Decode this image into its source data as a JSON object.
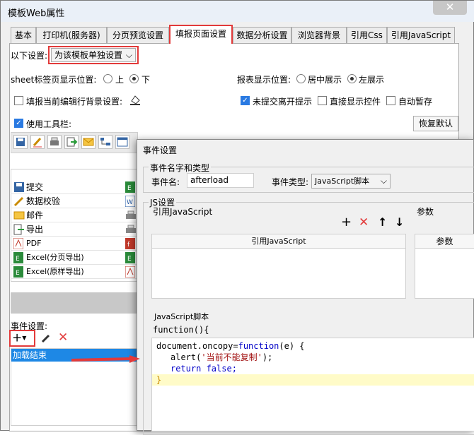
{
  "window": {
    "title": "模板Web属性",
    "close": "✕"
  },
  "tabs": [
    "基本",
    "打印机(服务器)",
    "分页预览设置",
    "填报页面设置",
    "数据分析设置",
    "浏览器背景",
    "引用Css",
    "引用JavaScript"
  ],
  "settings": {
    "apply_label": "以下设置:",
    "apply_value": "为该模板单独设置",
    "sheet_label": "sheet标签页显示位置:",
    "sheet_top": "上",
    "sheet_bottom": "下",
    "report_label": "报表显示位置:",
    "report_center": "居中展示",
    "report_left": "左展示",
    "fill_bg_label": "填报当前编辑行背景设置:",
    "unsubmitted_label": "未提交离开提示",
    "show_controls_label": "直接显示控件",
    "autosave_label": "自动暂存",
    "toolbar_label": "使用工具栏:",
    "restore_default": "恢复默认"
  },
  "toolbar_buttons": [
    {
      "label": "提交",
      "icon": "save-icon"
    },
    {
      "label": "数据校验",
      "icon": "pencil-check-icon"
    },
    {
      "label": "邮件",
      "icon": "mail-icon"
    },
    {
      "label": "导出",
      "icon": "export-icon"
    },
    {
      "label": "PDF",
      "icon": "pdf-icon"
    },
    {
      "label": "Excel(分页导出)",
      "icon": "excel-icon"
    },
    {
      "label": "Excel(原样导出)",
      "icon": "excel-icon"
    }
  ],
  "events": {
    "label": "事件设置:",
    "item": "加载结束"
  },
  "dialog": {
    "title": "事件设置",
    "group_name": "事件名字和类型",
    "event_name_label": "事件名:",
    "event_name_value": "afterload",
    "event_type_label": "事件类型:",
    "event_type_value": "JavaScript脚本",
    "js_group": "JS设置",
    "ref_js_label": "引用JavaScript",
    "params_label": "参数",
    "ref_js_col": "引用JavaScript",
    "params_col": "参数",
    "script_label": "JavaScript脚本",
    "func_header": "function(){",
    "code_line1_a": "document.oncopy=",
    "code_line1_kw": "function",
    "code_line1_b": "(e) {",
    "code_line2_a": "alert(",
    "code_line2_str": "'当前不能复制'",
    "code_line2_b": ");",
    "code_line3_kw": "return",
    "code_line3_b": " false;",
    "code_line4": "}"
  },
  "colors": {
    "accent": "#e23a3a",
    "selection": "#1e88e5",
    "highlight": "#fffbc8"
  }
}
